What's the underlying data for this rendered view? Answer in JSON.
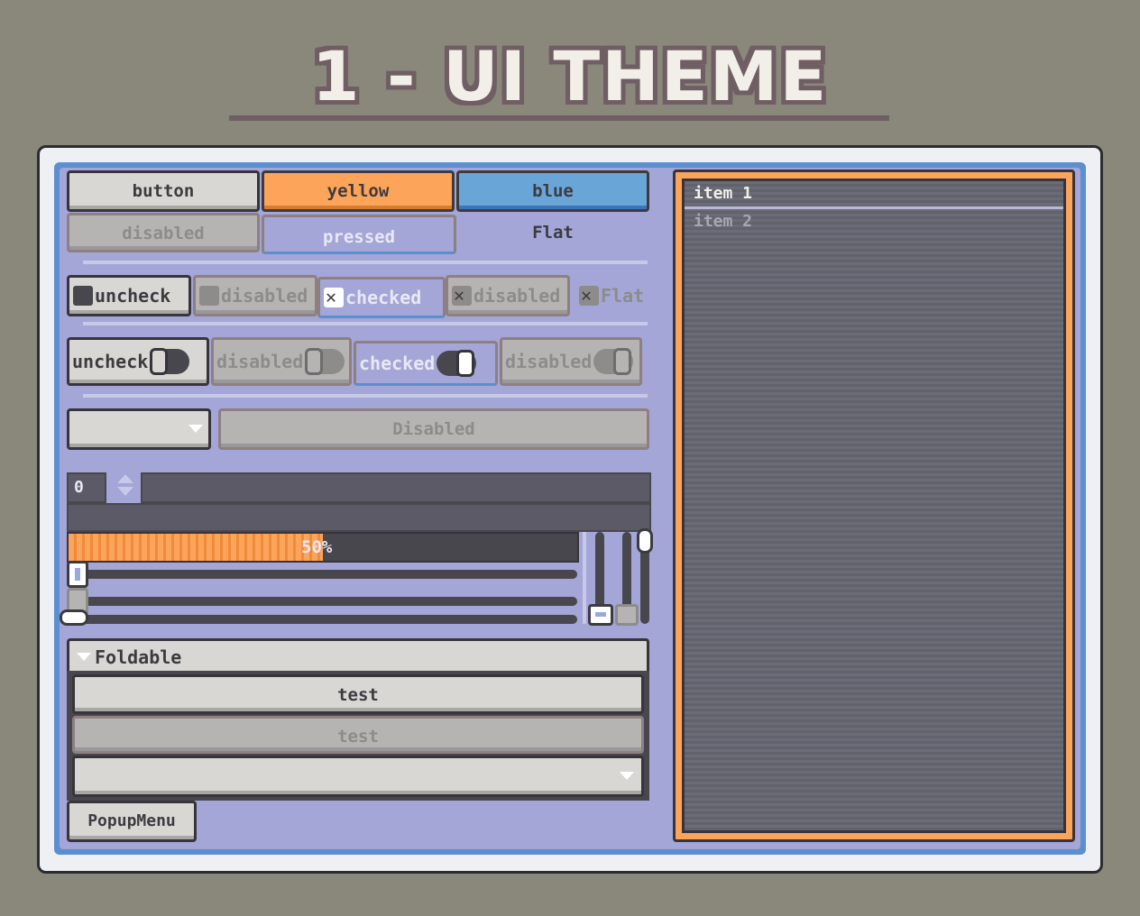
{
  "title": "1 - UI THEME",
  "buttons": {
    "row1": [
      "button",
      "yellow",
      "blue"
    ],
    "row2": [
      "disabled",
      "pressed",
      "Flat"
    ]
  },
  "checkboxes": [
    "uncheck",
    "disabled",
    "checked",
    "disabled",
    "Flat"
  ],
  "toggles": [
    "uncheck",
    "disabled",
    "checked",
    "disabled"
  ],
  "option_disabled_label": "Disabled",
  "spinbox_value": "0",
  "progress": {
    "value": 0.5,
    "label": "50%"
  },
  "foldable": {
    "header": "Foldable",
    "buttons": [
      "test",
      "test"
    ]
  },
  "popup_menu_label": "PopupMenu",
  "list": {
    "items": [
      "item 1",
      "item 2"
    ]
  },
  "colors": {
    "background": "#8a877b",
    "panel": "#a3a6d6",
    "accent_orange": "#fba45a",
    "accent_blue": "#6aa5d8",
    "dark": "#48474d",
    "title_outline": "#6f5e63"
  }
}
